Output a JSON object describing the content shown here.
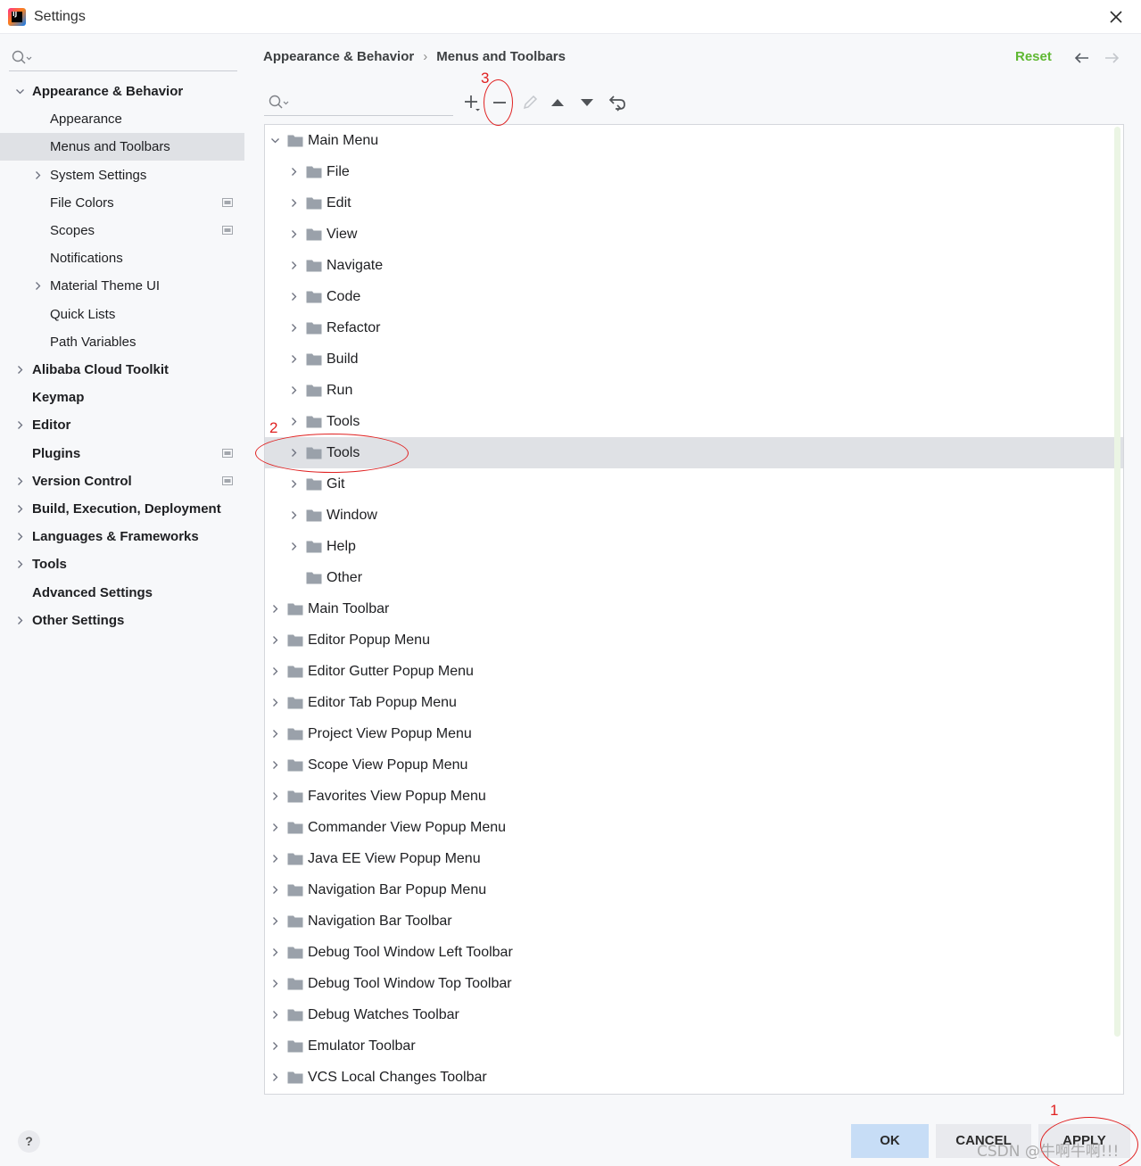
{
  "window": {
    "title": "Settings"
  },
  "sidebar": {
    "items": [
      {
        "label": "Appearance & Behavior",
        "level": 0,
        "bold": true,
        "chevron": "down"
      },
      {
        "label": "Appearance",
        "level": 1,
        "bold": false,
        "chevron": "none"
      },
      {
        "label": "Menus and Toolbars",
        "level": 1,
        "bold": false,
        "chevron": "none",
        "selected": true
      },
      {
        "label": "System Settings",
        "level": 1,
        "bold": false,
        "chevron": "right"
      },
      {
        "label": "File Colors",
        "level": 1,
        "bold": false,
        "chevron": "none",
        "project_icon": true
      },
      {
        "label": "Scopes",
        "level": 1,
        "bold": false,
        "chevron": "none",
        "project_icon": true
      },
      {
        "label": "Notifications",
        "level": 1,
        "bold": false,
        "chevron": "none"
      },
      {
        "label": "Material Theme UI",
        "level": 1,
        "bold": false,
        "chevron": "right"
      },
      {
        "label": "Quick Lists",
        "level": 1,
        "bold": false,
        "chevron": "none"
      },
      {
        "label": "Path Variables",
        "level": 1,
        "bold": false,
        "chevron": "none"
      },
      {
        "label": "Alibaba Cloud Toolkit",
        "level": 0,
        "bold": true,
        "chevron": "right"
      },
      {
        "label": "Keymap",
        "level": 0,
        "bold": true,
        "chevron": "none"
      },
      {
        "label": "Editor",
        "level": 0,
        "bold": true,
        "chevron": "right"
      },
      {
        "label": "Plugins",
        "level": 0,
        "bold": true,
        "chevron": "none",
        "project_icon": true
      },
      {
        "label": "Version Control",
        "level": 0,
        "bold": true,
        "chevron": "right",
        "project_icon": true
      },
      {
        "label": "Build, Execution, Deployment",
        "level": 0,
        "bold": true,
        "chevron": "right"
      },
      {
        "label": "Languages & Frameworks",
        "level": 0,
        "bold": true,
        "chevron": "right"
      },
      {
        "label": "Tools",
        "level": 0,
        "bold": true,
        "chevron": "right"
      },
      {
        "label": "Advanced Settings",
        "level": 0,
        "bold": true,
        "chevron": "none"
      },
      {
        "label": "Other Settings",
        "level": 0,
        "bold": true,
        "chevron": "right"
      }
    ]
  },
  "header": {
    "breadcrumb": [
      "Appearance & Behavior",
      "Menus and Toolbars"
    ],
    "breadcrumb_separator": "›",
    "reset_label": "Reset"
  },
  "toolbar": {
    "buttons": [
      "add-icon",
      "remove-icon",
      "edit-icon",
      "move-up-icon",
      "move-down-icon",
      "restore-icon"
    ]
  },
  "tree": {
    "rows": [
      {
        "label": "Main Menu",
        "level": 0,
        "chevron": "down"
      },
      {
        "label": "File",
        "level": 1,
        "chevron": "right"
      },
      {
        "label": "Edit",
        "level": 1,
        "chevron": "right"
      },
      {
        "label": "View",
        "level": 1,
        "chevron": "right"
      },
      {
        "label": "Navigate",
        "level": 1,
        "chevron": "right"
      },
      {
        "label": "Code",
        "level": 1,
        "chevron": "right"
      },
      {
        "label": "Refactor",
        "level": 1,
        "chevron": "right"
      },
      {
        "label": "Build",
        "level": 1,
        "chevron": "right"
      },
      {
        "label": "Run",
        "level": 1,
        "chevron": "right"
      },
      {
        "label": "Tools",
        "level": 1,
        "chevron": "right"
      },
      {
        "label": "Tools",
        "level": 1,
        "chevron": "right",
        "selected": true
      },
      {
        "label": "Git",
        "level": 1,
        "chevron": "right"
      },
      {
        "label": "Window",
        "level": 1,
        "chevron": "right"
      },
      {
        "label": "Help",
        "level": 1,
        "chevron": "right"
      },
      {
        "label": "Other",
        "level": 1,
        "chevron": "none"
      },
      {
        "label": "Main Toolbar",
        "level": 0,
        "chevron": "right"
      },
      {
        "label": "Editor Popup Menu",
        "level": 0,
        "chevron": "right"
      },
      {
        "label": "Editor Gutter Popup Menu",
        "level": 0,
        "chevron": "right"
      },
      {
        "label": "Editor Tab Popup Menu",
        "level": 0,
        "chevron": "right"
      },
      {
        "label": "Project View Popup Menu",
        "level": 0,
        "chevron": "right"
      },
      {
        "label": "Scope View Popup Menu",
        "level": 0,
        "chevron": "right"
      },
      {
        "label": "Favorites View Popup Menu",
        "level": 0,
        "chevron": "right"
      },
      {
        "label": "Commander View Popup Menu",
        "level": 0,
        "chevron": "right"
      },
      {
        "label": "Java EE View Popup Menu",
        "level": 0,
        "chevron": "right"
      },
      {
        "label": "Navigation Bar Popup Menu",
        "level": 0,
        "chevron": "right"
      },
      {
        "label": "Navigation Bar Toolbar",
        "level": 0,
        "chevron": "right"
      },
      {
        "label": "Debug Tool Window Left Toolbar",
        "level": 0,
        "chevron": "right"
      },
      {
        "label": "Debug Tool Window Top Toolbar",
        "level": 0,
        "chevron": "right"
      },
      {
        "label": "Debug Watches Toolbar",
        "level": 0,
        "chevron": "right"
      },
      {
        "label": "Emulator Toolbar",
        "level": 0,
        "chevron": "right"
      },
      {
        "label": "VCS Local Changes Toolbar",
        "level": 0,
        "chevron": "right"
      }
    ]
  },
  "footer": {
    "help_label": "?",
    "ok_label": "OK",
    "cancel_label": "CANCEL",
    "apply_label": "APPLY"
  },
  "annotations": {
    "apply_marker": "1",
    "tools_marker": "2",
    "remove_marker": "3"
  },
  "watermark": "CSDN @牛啊牛啊!!!",
  "colors": {
    "accent_reset": "#5fb832",
    "selection": "#dfe1e5",
    "ok_button": "#c7ddf6",
    "annotation": "#e02020"
  }
}
